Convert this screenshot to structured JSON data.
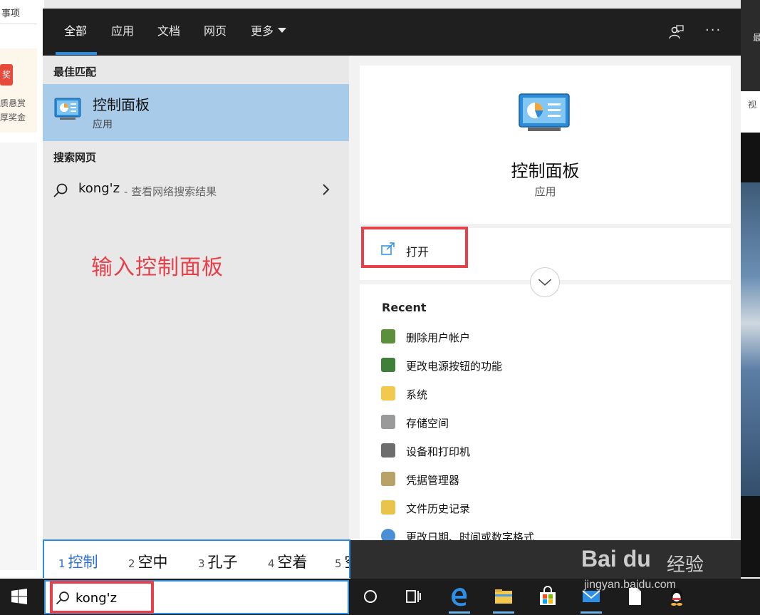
{
  "background": {
    "left_top_text": "事项",
    "left_promo_badge": "奖",
    "left_promo_line1": "质悬赏",
    "left_promo_line2": "厚奖金",
    "right_top_text": "最",
    "right_strip_text": "视"
  },
  "search_panel": {
    "tabs": [
      {
        "label": "全部",
        "active": true
      },
      {
        "label": "应用",
        "active": false
      },
      {
        "label": "文档",
        "active": false
      },
      {
        "label": "网页",
        "active": false
      },
      {
        "label": "更多",
        "active": false,
        "has_dropdown": true
      }
    ],
    "feedback_icon": "feedback-icon",
    "more_options_icon": "ellipsis-icon",
    "more_options_glyph": "···",
    "best_match": {
      "heading": "最佳匹配",
      "title": "控制面板",
      "subtitle": "应用",
      "icon": "control-panel-icon"
    },
    "web_search": {
      "heading": "搜索网页",
      "query": "kong'z",
      "description": " - 查看网络搜索结果"
    },
    "annotation": "输入控制面板",
    "preview": {
      "title": "控制面板",
      "subtitle": "应用",
      "open_label": "打开",
      "recent_heading": "Recent",
      "recent_items": [
        {
          "label": "删除用户帐户",
          "icon": "users-icon",
          "color": "#5b8f3a"
        },
        {
          "label": "更改电源按钮的功能",
          "icon": "power-icon",
          "color": "#3f7f3a"
        },
        {
          "label": "系统",
          "icon": "folder-icon",
          "color": "#f2c94c"
        },
        {
          "label": "存储空间",
          "icon": "storage-icon",
          "color": "#9a9a9a"
        },
        {
          "label": "设备和打印机",
          "icon": "printer-icon",
          "color": "#6d6d6d"
        },
        {
          "label": "凭据管理器",
          "icon": "credential-icon",
          "color": "#b8a26a"
        },
        {
          "label": "文件历史记录",
          "icon": "file-history-icon",
          "color": "#e8c44a"
        },
        {
          "label": "更改日期、时间或数字格式",
          "icon": "globe-icon",
          "color": "#4a8fd6"
        }
      ]
    }
  },
  "ime": {
    "candidates": [
      {
        "num": "1",
        "text": "控制",
        "selected": true
      },
      {
        "num": "2",
        "text": "空中",
        "selected": false
      },
      {
        "num": "3",
        "text": "孔子",
        "selected": false
      },
      {
        "num": "4",
        "text": "空着",
        "selected": false
      },
      {
        "num": "5",
        "text": "空",
        "selected": false
      }
    ]
  },
  "taskbar": {
    "search_value": "kong'z",
    "icons": [
      "windows-start-icon",
      "cortana-icon",
      "task-view-icon",
      "edge-icon",
      "file-explorer-icon",
      "store-icon",
      "mail-icon",
      "notepad-icon",
      "qq-icon"
    ]
  },
  "watermark": {
    "logo_text": "Bai  du",
    "cn_text": "经验",
    "url": "jingyan.baidu.com"
  },
  "colors": {
    "accent": "#2b8ee0",
    "highlight_red": "#e8404a",
    "best_match_bg": "#a8cbe9",
    "topbar_bg": "#1f1f1f"
  }
}
